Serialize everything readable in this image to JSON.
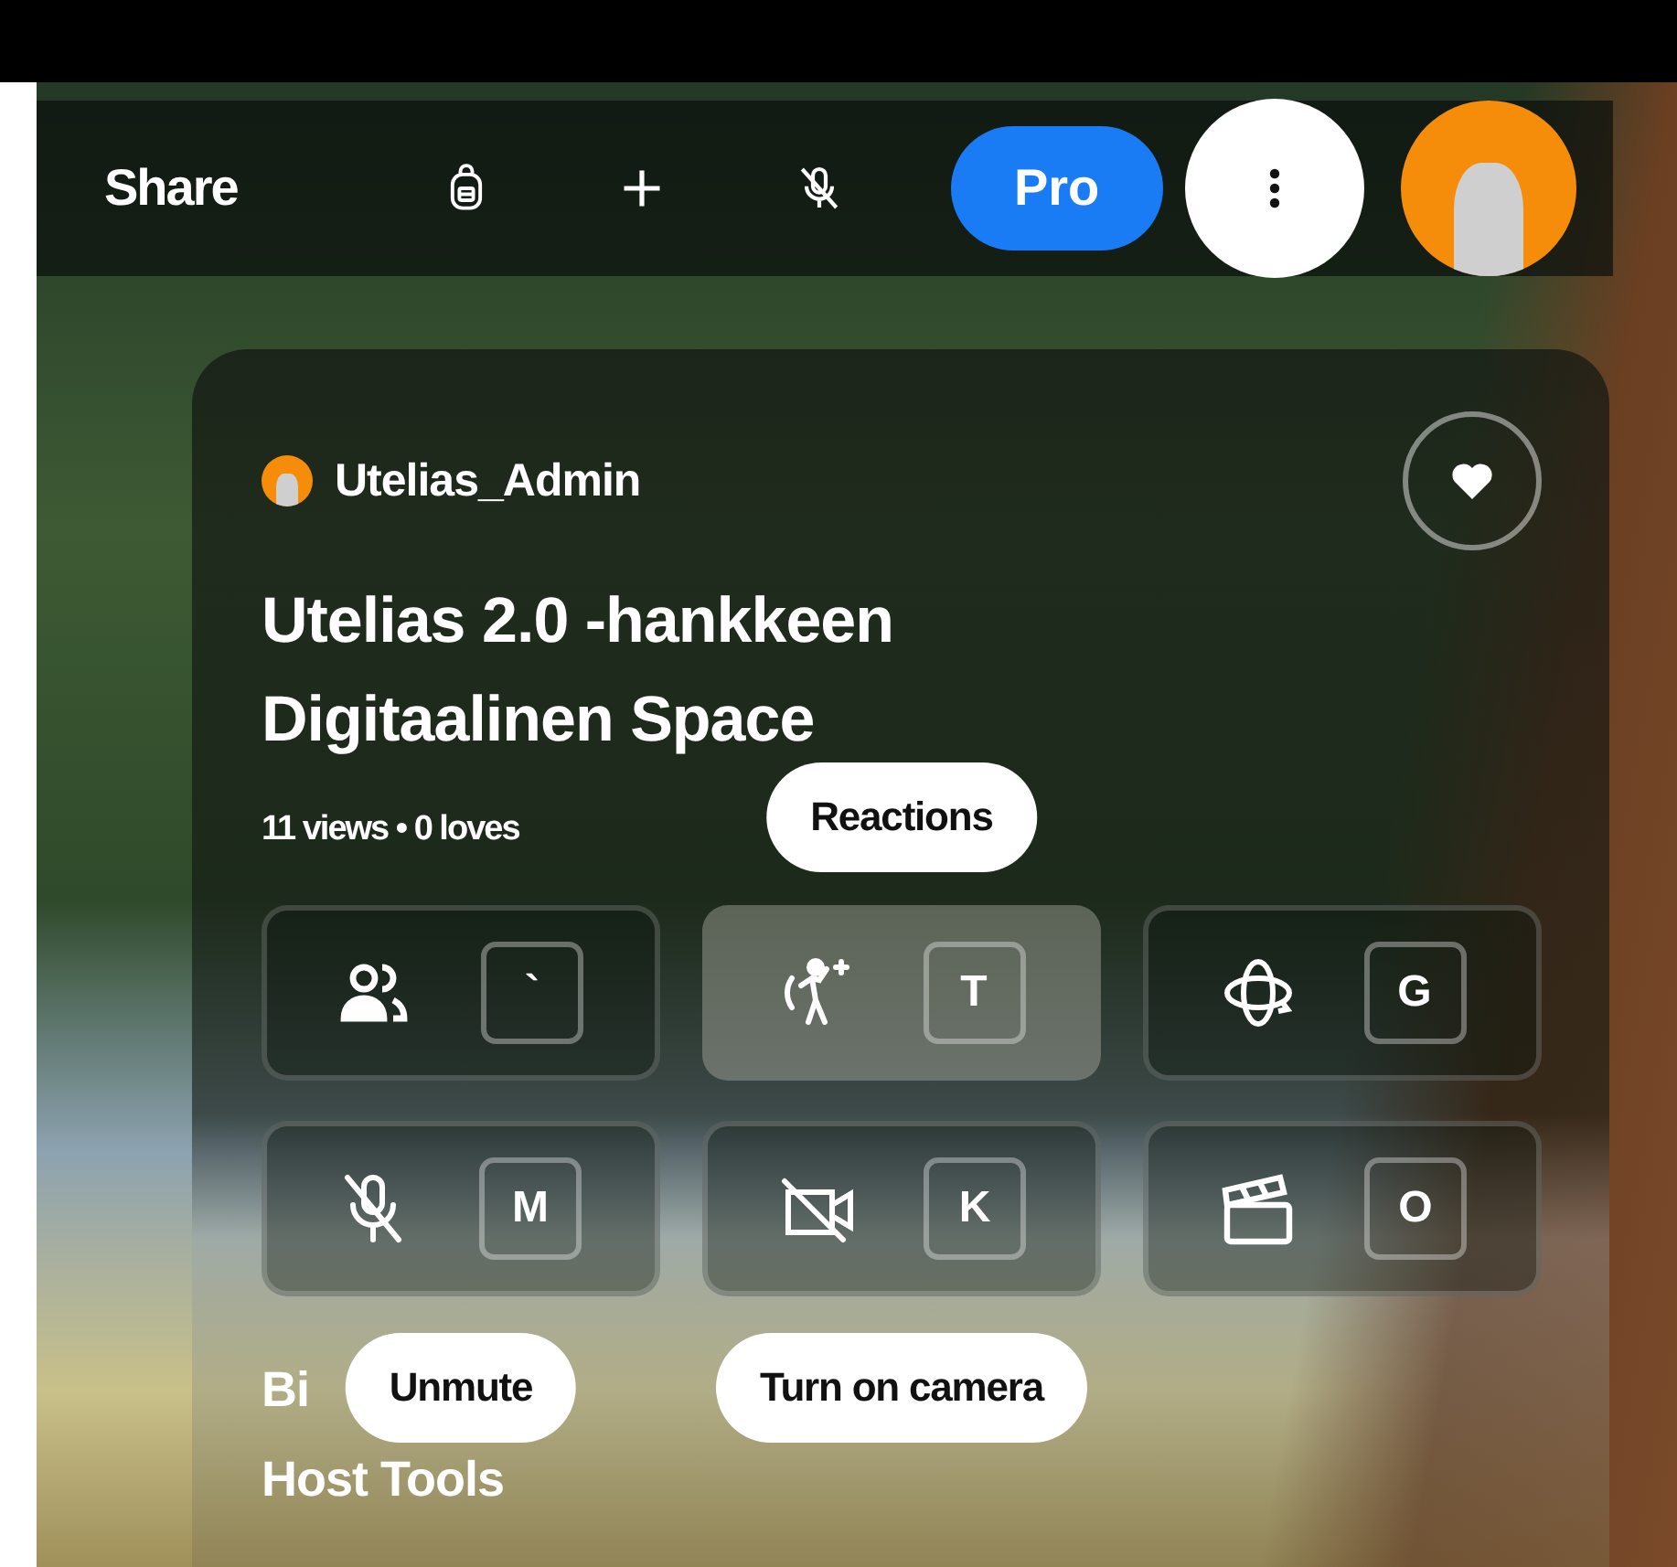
{
  "top_bar": {
    "share_label": "Share",
    "pro_label": "Pro"
  },
  "card": {
    "author": "Utelias_Admin",
    "loved": false,
    "title": "Utelias 2.0 -hankkeen Digitaalinen Space",
    "stats": "11 views • 0 loves",
    "tiles": [
      {
        "kind": "people",
        "key": "`",
        "highlighted": false
      },
      {
        "kind": "reactions",
        "key": "T",
        "highlighted": true,
        "tooltip": "Reactions",
        "tooltip_above": true
      },
      {
        "kind": "orbit",
        "key": "G",
        "highlighted": false
      },
      {
        "kind": "mic-off",
        "key": "M",
        "highlighted": false,
        "tooltip": "Unmute",
        "tooltip_above": false
      },
      {
        "kind": "camera-off",
        "key": "K",
        "highlighted": false,
        "tooltip": "Turn on camera",
        "tooltip_above": false
      },
      {
        "kind": "clapper",
        "key": "O",
        "highlighted": false
      }
    ],
    "sections": [
      "Bi",
      "Host Tools"
    ]
  }
}
